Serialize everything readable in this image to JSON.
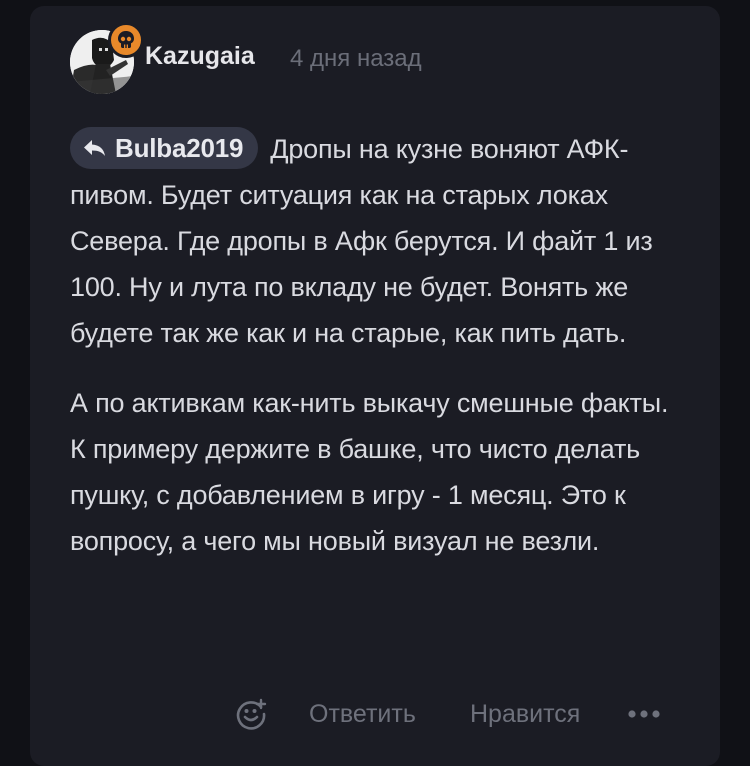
{
  "comment": {
    "author": "Kazugaia",
    "time": "4 дня назад",
    "reply_to": "Bulba2019",
    "paragraph1": "Дропы на кузне воняют АФК-пивом. Будет ситуация как на старых локах Севера. Где дропы в Афк берутся. И файт 1 из 100. Ну и лута по вкладу не будет. Вонять же будете так же как и на старые, как пить дать.",
    "paragraph2": "А по активкам как-нить выкачу смешные факты. К примеру держите в башке, что чисто делать пушку, с добавлением в игру - 1 месяц. Это к вопросу, а чего мы новый визуал не везли."
  },
  "actions": {
    "reply_label": "Ответить",
    "like_label": "Нравится"
  },
  "icons": {
    "badge": "skull-icon",
    "reply_chip": "reply-arrow-icon",
    "emoji": "smiley-icon",
    "more": "more-dots-icon"
  },
  "colors": {
    "card": "#1b1c24",
    "badge": "#e8892a",
    "chip": "#343746",
    "muted": "#6e717c"
  }
}
